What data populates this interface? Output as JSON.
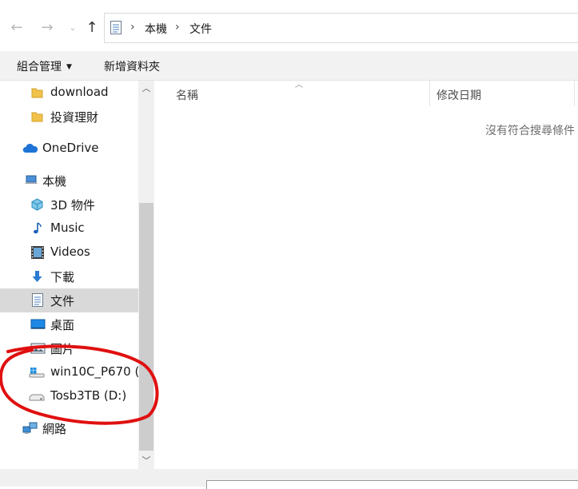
{
  "address": {
    "back_icon": "back-arrow-icon",
    "forward_icon": "forward-arrow-icon",
    "recent_icon": "chevron-down-icon",
    "up_icon": "up-arrow-icon",
    "breadcrumb": [
      "本機",
      "文件"
    ]
  },
  "toolbar": {
    "organize_label": "組合管理",
    "new_folder_label": "新增資料夾"
  },
  "sidebar": {
    "items": [
      {
        "label": "download",
        "icon": "folder-icon"
      },
      {
        "label": "投資理財",
        "icon": "folder-icon"
      },
      {
        "label": "OneDrive",
        "icon": "cloud-icon"
      },
      {
        "label": "本機",
        "icon": "computer-icon"
      },
      {
        "label": "3D 物件",
        "icon": "cube-icon"
      },
      {
        "label": "Music",
        "icon": "music-note-icon"
      },
      {
        "label": "Videos",
        "icon": "film-icon"
      },
      {
        "label": "下載",
        "icon": "download-arrow-icon"
      },
      {
        "label": "文件",
        "icon": "document-icon"
      },
      {
        "label": "桌面",
        "icon": "desktop-icon"
      },
      {
        "label": "圖片",
        "icon": "picture-icon"
      },
      {
        "label": "win10C_P670 (",
        "icon": "windows-drive-icon"
      },
      {
        "label": "Tosb3TB (D:)",
        "icon": "drive-icon"
      },
      {
        "label": "網路",
        "icon": "network-icon"
      }
    ]
  },
  "content": {
    "columns": [
      "名稱",
      "修改日期"
    ],
    "empty_message": "沒有符合搜尋條件"
  },
  "annotation_color": "#e01010",
  "selection_color": "#d9d9d9"
}
